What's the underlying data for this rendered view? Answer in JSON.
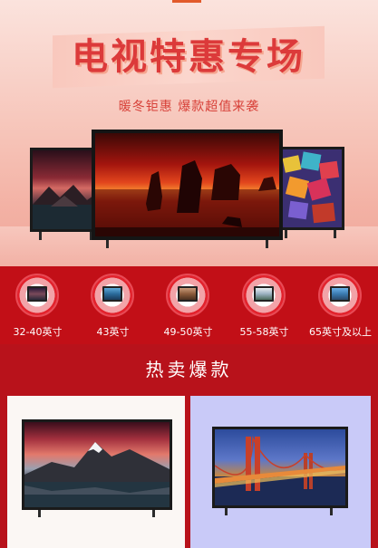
{
  "banner": {
    "title": "电视特惠专场",
    "subtitle": "暖冬钜惠  爆款超值来袭"
  },
  "categories": [
    {
      "label": "32-40英寸",
      "icon": "tv-thumbnail-icon"
    },
    {
      "label": "43英寸",
      "icon": "tv-thumbnail-icon"
    },
    {
      "label": "49-50英寸",
      "icon": "tv-thumbnail-icon"
    },
    {
      "label": "55-58英寸",
      "icon": "tv-thumbnail-icon"
    },
    {
      "label": "65英寸及以上",
      "icon": "tv-thumbnail-icon"
    }
  ],
  "hot_section": {
    "title": "热卖爆款"
  },
  "colors": {
    "accent_red": "#c8101a",
    "banner_pink": "#f6c1b5",
    "title_red": "#dc3a3a",
    "card_left_bg": "#fbf7f4",
    "card_right_bg": "#c9caf8"
  }
}
